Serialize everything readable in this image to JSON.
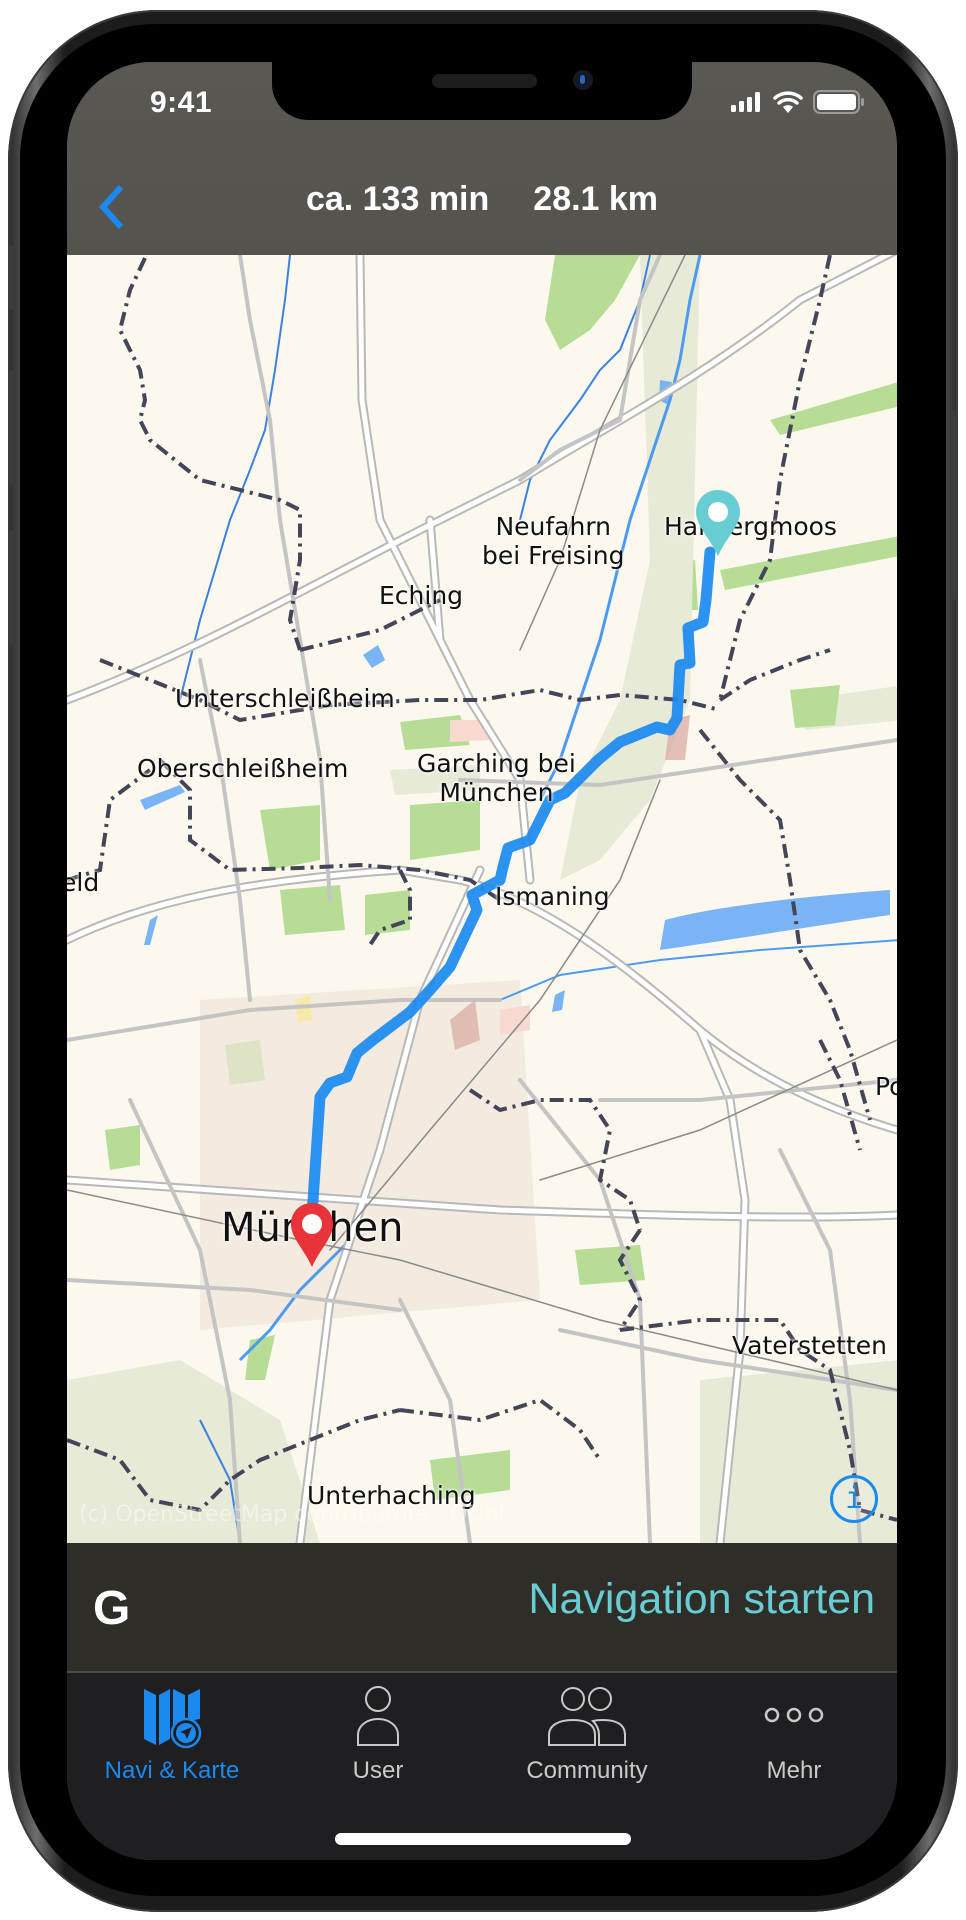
{
  "status_bar": {
    "time": "9:41",
    "icons": [
      "cellular-signal-icon",
      "wifi-icon",
      "battery-icon"
    ]
  },
  "header": {
    "back_icon": "chevron-left-icon",
    "duration": "ca. 133 min",
    "distance": "28.1 km"
  },
  "map": {
    "labels": [
      {
        "id": "neufahrn",
        "text": "Neufahrn\nbei Freising"
      },
      {
        "id": "hallbergmoos",
        "text": "Hallbergmoos"
      },
      {
        "id": "eching",
        "text": "Eching"
      },
      {
        "id": "unterschleissheim",
        "text": "Unterschleißheim"
      },
      {
        "id": "oberschleissheim",
        "text": "Oberschleißheim"
      },
      {
        "id": "garching",
        "text": "Garching bei\nMünchen"
      },
      {
        "id": "karlsfeld",
        "text": "eld"
      },
      {
        "id": "ismaning",
        "text": "Ismaning"
      },
      {
        "id": "poing",
        "text": "Po"
      },
      {
        "id": "muenchen",
        "text": "München"
      },
      {
        "id": "vaterstetten",
        "text": "Vaterstetten"
      },
      {
        "id": "unterhaching",
        "text": "Unterhaching"
      }
    ],
    "attribution": "(c) OpenStreetMap contributors - ODbL",
    "info_button": "i",
    "start_marker": {
      "label": "Start",
      "color": "#67cdd3"
    },
    "end_marker": {
      "label": "Ziel",
      "color": "#e8333a"
    },
    "route_color": "#1a8af0"
  },
  "action_bar": {
    "logo": "G",
    "start_navigation": "Navigation starten"
  },
  "tab_bar": {
    "tabs": [
      {
        "label": "Navi & Karte",
        "icon": "map-navigation-icon",
        "active": true
      },
      {
        "label": "User",
        "icon": "user-icon",
        "active": false
      },
      {
        "label": "Community",
        "icon": "community-icon",
        "active": false
      },
      {
        "label": "Mehr",
        "icon": "more-icon",
        "active": false
      }
    ]
  },
  "colors": {
    "accent_blue": "#1a8af0",
    "accent_teal": "#67cdd3",
    "header_bg": "#57554f",
    "tab_bar_bg": "#1f1f21"
  }
}
